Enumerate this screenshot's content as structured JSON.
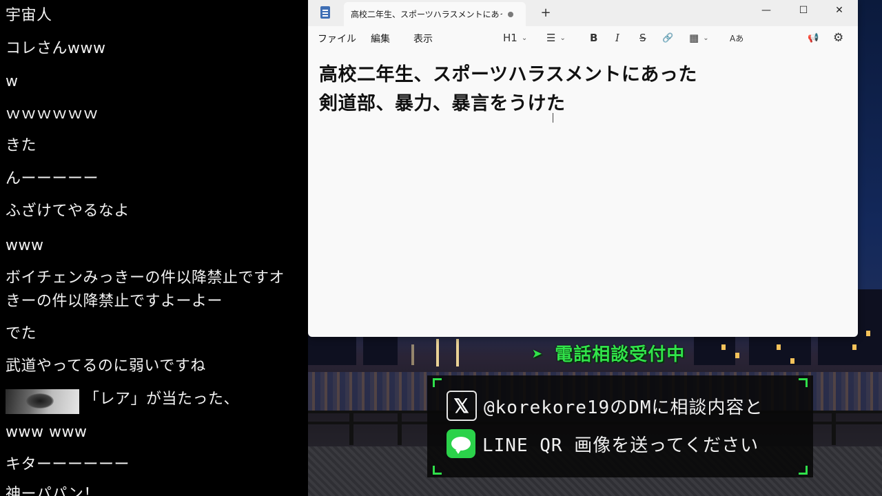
{
  "chat": {
    "messages": [
      "宇宙人",
      "コレさんwww",
      "w",
      "ｗｗｗｗｗｗ",
      "きた",
      "んーーーーー",
      "ふざけてやるなよ",
      "www",
      "ボイチェンみっきーの件以降禁止ですオ",
      "きーの件以降禁止ですよーよー",
      "でた",
      "武道やってるのに弱いですね",
      "「レア」が当たった、",
      "www www",
      "キターーーーーー",
      "神ーパパン！"
    ]
  },
  "notepad": {
    "tab_title": "高校二年生、スポーツハラスメントにあった",
    "new_tab": "+",
    "controls": {
      "minimize": "—",
      "maximize": "☐",
      "close": "✕"
    },
    "menu": {
      "file": "ファイル",
      "edit": "編集",
      "view": "表示"
    },
    "toolbar": {
      "heading": "H1",
      "list": "☰",
      "bold": "B",
      "italic": "I",
      "strikethrough": "S",
      "link": "🔗",
      "table": "▦",
      "spell": "Aあ",
      "feedback": "📢",
      "settings": "⚙"
    },
    "document": {
      "line1": "高校二年生、スポーツハラスメントにあった",
      "line2": "剣道部、暴力、暴言をうけた"
    }
  },
  "overlay": {
    "phone_banner": "➤ 電話相談受付中",
    "x_text": "@korekore19のDMに相談内容と",
    "line_text": "LINE QR 画像を送ってください",
    "x_glyph": "𝕏",
    "accent_color": "#31e34a"
  }
}
